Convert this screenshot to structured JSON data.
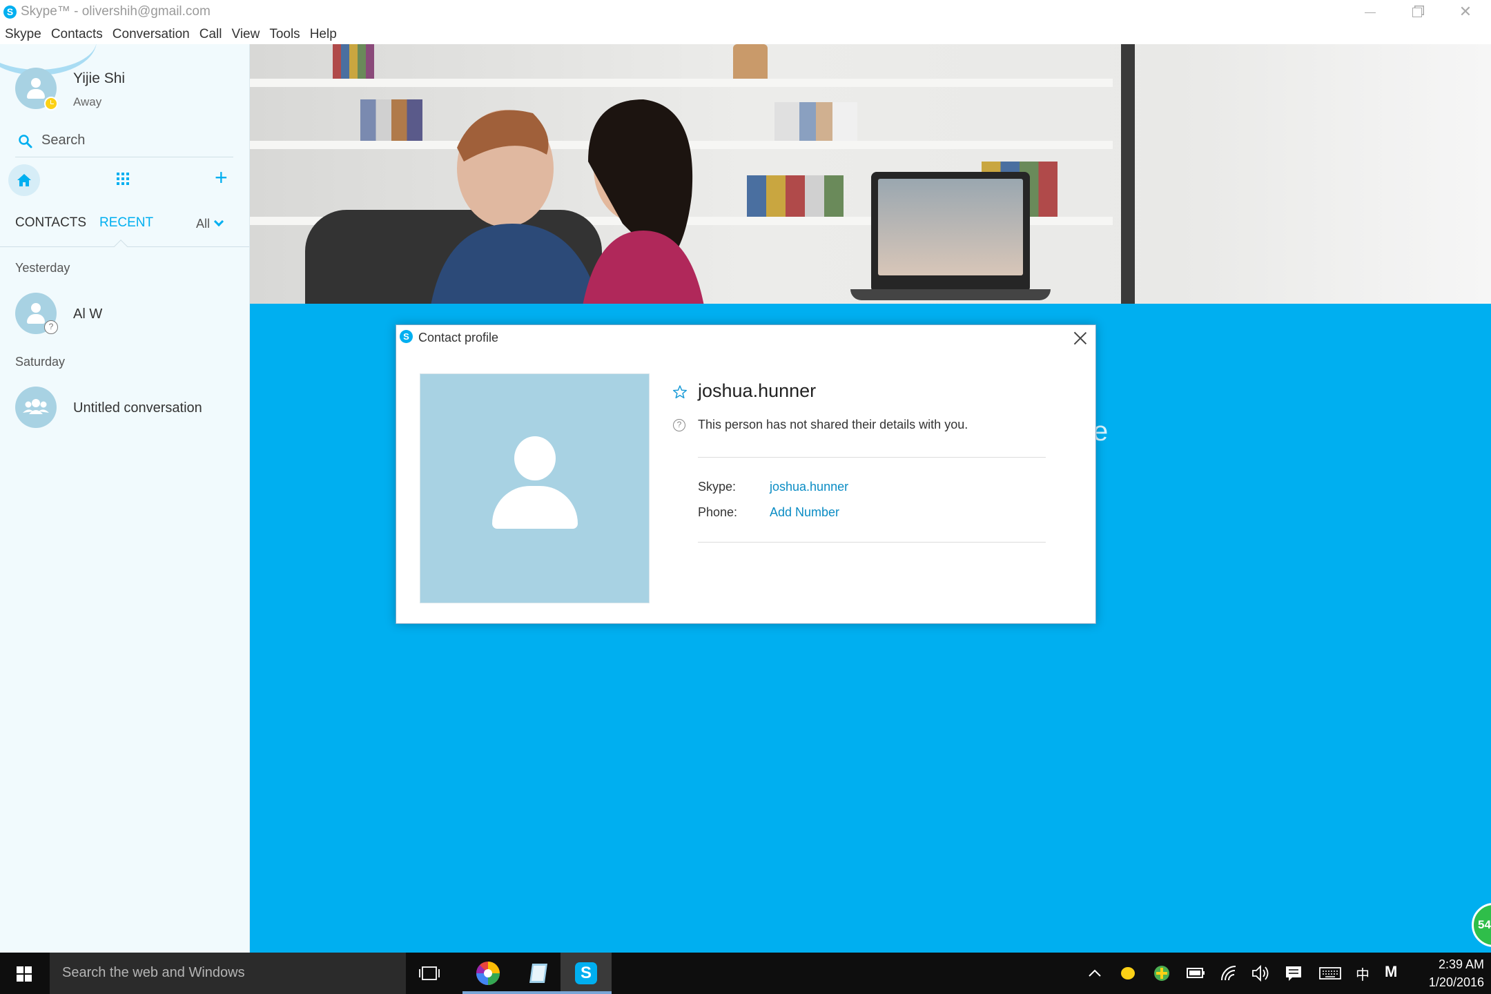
{
  "window": {
    "title": "Skype™ - olivershih@gmail.com",
    "app_icon_letter": "S"
  },
  "menu": {
    "items": [
      "Skype",
      "Contacts",
      "Conversation",
      "Call",
      "View",
      "Tools",
      "Help"
    ]
  },
  "profile": {
    "name": "Yijie Shi",
    "status": "Away",
    "status_color": "#fcd116"
  },
  "sidebar": {
    "search_label": "Search",
    "tabs": {
      "contacts": "CONTACTS",
      "recent": "RECENT",
      "active": "RECENT",
      "filter": "All"
    },
    "groups": [
      {
        "label": "Yesterday",
        "items": [
          {
            "name": "Al W",
            "badge": "?"
          }
        ]
      },
      {
        "label": "Saturday",
        "items": [
          {
            "name": "Untitled conversation"
          }
        ]
      }
    ]
  },
  "main": {
    "background_partial_text": "e",
    "accent_color": "#00aff0",
    "floating_badge": "54"
  },
  "dialog": {
    "title": "Contact profile",
    "contact_name": "joshua.hunner",
    "notice": "This person has not shared their details with you.",
    "fields": {
      "skype_label": "Skype:",
      "skype_value": "joshua.hunner",
      "phone_label": "Phone:",
      "phone_value": "Add Number"
    }
  },
  "taskbar": {
    "search_placeholder": "Search the web and Windows",
    "time": "2:39 AM",
    "date": "1/20/2016",
    "ime_label": "中",
    "ime_mode": "M"
  }
}
